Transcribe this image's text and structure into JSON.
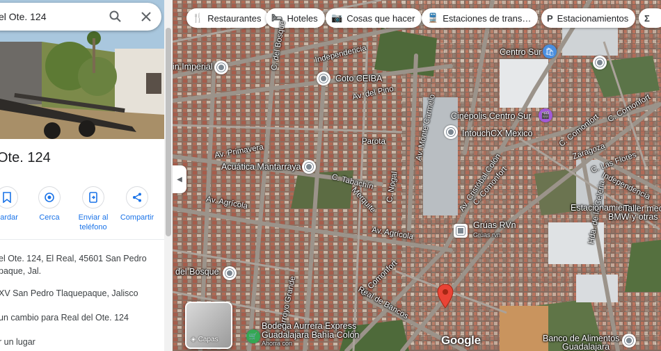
{
  "search": {
    "value": "el Ote. 124"
  },
  "place": {
    "title": "Ote. 124",
    "actions": [
      {
        "label": "uardar",
        "icon": "bookmark-icon"
      },
      {
        "label": "Cerca",
        "icon": "nearby-icon"
      },
      {
        "label": "Enviar al\nteléfono",
        "icon": "send-to-phone-icon"
      },
      {
        "label": "Compartir",
        "icon": "share-icon"
      }
    ],
    "address_line1": "el Ote. 124, El Real, 45601 San Pedro",
    "address_line2": "paque, Jal.",
    "plus_code": "XV San Pedro Tlaquepaque, Jalisco",
    "suggest_edit": "un cambio para Real del Ote. 124",
    "add_place": "r un lugar"
  },
  "filters": [
    {
      "label": "Restaurantes",
      "icon": "restaurant-icon"
    },
    {
      "label": "Hoteles",
      "icon": "hotel-icon"
    },
    {
      "label": "Cosas que hacer",
      "icon": "camera-icon"
    },
    {
      "label": "Estaciones de trans…",
      "icon": "transit-icon"
    },
    {
      "label": "Estacionamientos",
      "icon": "parking-icon"
    }
  ],
  "map_labels": {
    "independencia_top": "Independencia",
    "in_imperial": "in Imperial",
    "coto_ceiba": "Coto CEIBA",
    "c_del_bosque": "C. del Bosque",
    "av_del_pino": "Av. del Pino",
    "av_monte_carmelo": "Av. Monte Carmelo",
    "centro_sur": "Centro Sur",
    "cinepolis": "Cinépolis Centro Sur",
    "intouchcx": "IntouchCX Mexico",
    "c_comonfort_right": "C. Comonfort",
    "zaragoza": "Zaragoza",
    "parota": "Parota",
    "av_primavera": "Av. Primavera",
    "acuatica": "Acuática Mantarraya",
    "c_tabachin": "C. Tabachín",
    "c_nogal": "C. Nogal",
    "merquite": "Merquite",
    "av_cristobal_colon": "Av. Cristóbal Colón",
    "c_comonfort_mid": "C. Comonfort",
    "c_las_flores": "C. Las Flores",
    "independencia_right": "Independencia",
    "hda_celeria": "Hda. de la Celeria",
    "estacionamientos": "Estacionamientos",
    "taller": "Taller mecá",
    "taller2": "BMW y otras",
    "av_agricola_left": "Av. Agrícola",
    "av_agricola_mid": "Av. Agrícola",
    "gruas_rvn": "Grúas RVn",
    "gruas_sub": "Grúas rvn",
    "del_bosque": "del Bosque",
    "arroyo_grande": "Arroyo Grande",
    "c_comonfort_low": "C. Comonfort",
    "real_de_bancos": "Real de Bancos",
    "bodega_aurrera": "Bodega Aurrera Express",
    "bodega_aurrera2": "Guadalajara Bahía Colón",
    "bodega_aurrera3": "Ahorra con",
    "banco_alimentos": "Banco de Alimentos",
    "banco_alimentos2": "Guadalajara"
  },
  "layers": {
    "label": "Capas"
  },
  "google_logo": "Google"
}
